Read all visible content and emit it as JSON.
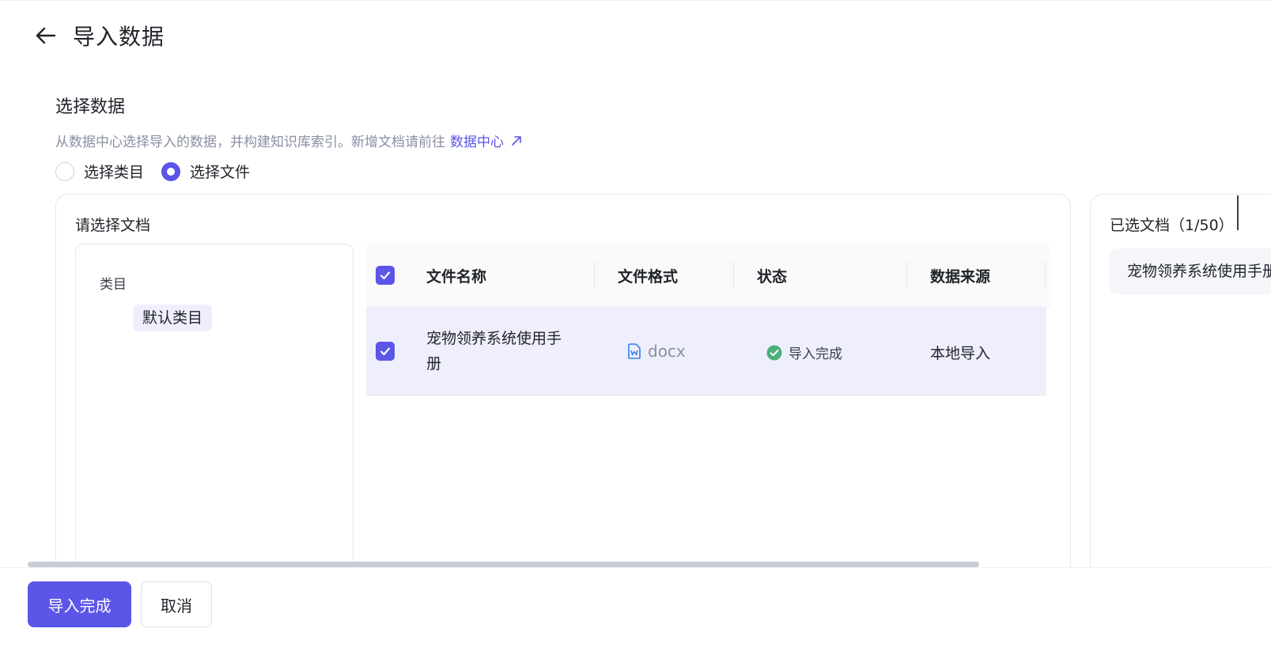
{
  "header": {
    "title": "导入数据"
  },
  "section": {
    "title": "选择数据",
    "description": "从数据中心选择导入的数据，并构建知识库索引。新增文档请前往",
    "link_label": "数据中心"
  },
  "radio_options": [
    {
      "label": "选择类目",
      "checked": false
    },
    {
      "label": "选择文件",
      "checked": true
    }
  ],
  "doc_selector": {
    "title": "请选择文档",
    "category_heading": "类目",
    "category_item": "默认类目"
  },
  "table": {
    "columns": [
      "文件名称",
      "文件格式",
      "状态",
      "数据来源"
    ],
    "rows": [
      {
        "name": "宠物领养系统使用手册",
        "format": "docx",
        "status": "导入完成",
        "source": "本地导入",
        "checked": true
      }
    ]
  },
  "selected_docs": {
    "title": "已选文档（1/50）",
    "items": [
      "宠物领养系统使用手册"
    ]
  },
  "footer": {
    "confirm_label": "导入完成",
    "cancel_label": "取消"
  },
  "colors": {
    "accent": "#5b55e8",
    "success": "#4caf7d",
    "row_selected": "#efeefc"
  }
}
